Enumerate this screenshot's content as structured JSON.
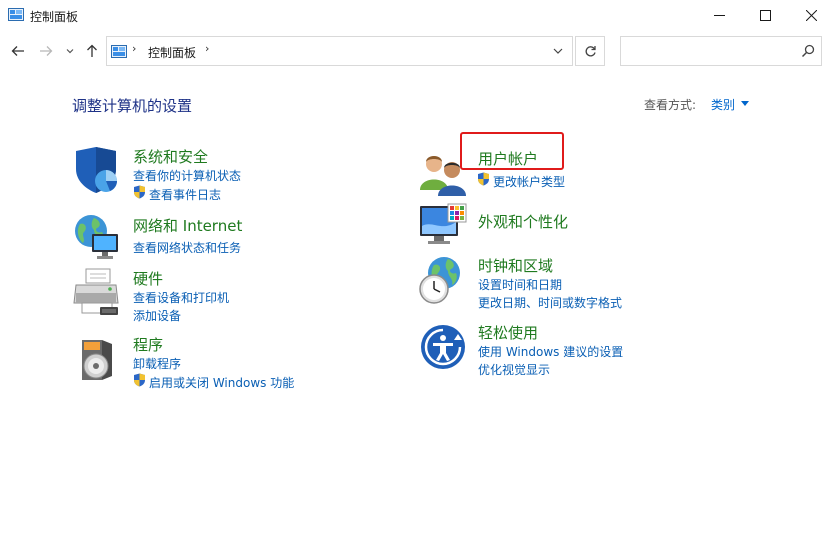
{
  "window": {
    "title": "控制面板"
  },
  "address": {
    "crumb": "控制面板",
    "separator": "›",
    "search_placeholder": ""
  },
  "heading": {
    "title": "调整计算机的设置",
    "view_by_label": "查看方式:",
    "view_by_value": "类别"
  },
  "categories": [
    {
      "title": "系统和安全",
      "icon": "shield-security-icon",
      "links": [
        {
          "label": "查看你的计算机状态",
          "shield": false
        },
        {
          "label": "查看事件日志",
          "shield": true
        }
      ]
    },
    {
      "title": "网络和 Internet",
      "icon": "network-globe-icon",
      "links": [
        {
          "label": "查看网络状态和任务",
          "shield": false
        }
      ]
    },
    {
      "title": "硬件",
      "icon": "printer-hardware-icon",
      "links": [
        {
          "label": "查看设备和打印机",
          "shield": false
        },
        {
          "label": "添加设备",
          "shield": false
        }
      ]
    },
    {
      "title": "程序",
      "icon": "programs-disc-icon",
      "links": [
        {
          "label": "卸载程序",
          "shield": false
        },
        {
          "label": "启用或关闭 Windows 功能",
          "shield": true
        }
      ]
    },
    {
      "title": "用户帐户",
      "icon": "user-accounts-icon",
      "links": [
        {
          "label": "更改帐户类型",
          "shield": true
        }
      ]
    },
    {
      "title": "外观和个性化",
      "icon": "appearance-monitor-icon",
      "links": []
    },
    {
      "title": "时钟和区域",
      "icon": "clock-globe-icon",
      "links": [
        {
          "label": "设置时间和日期",
          "shield": false
        },
        {
          "label": "更改日期、时间或数字格式",
          "shield": false
        }
      ]
    },
    {
      "title": "轻松使用",
      "icon": "ease-of-access-icon",
      "links": [
        {
          "label": "使用 Windows 建议的设置",
          "shield": false
        },
        {
          "label": "优化视觉显示",
          "shield": false
        }
      ]
    }
  ],
  "colors": {
    "category_title": "#1f7a1f",
    "link": "#0a5fb4",
    "heading": "#1e3287",
    "highlight": "#e01b1b"
  }
}
